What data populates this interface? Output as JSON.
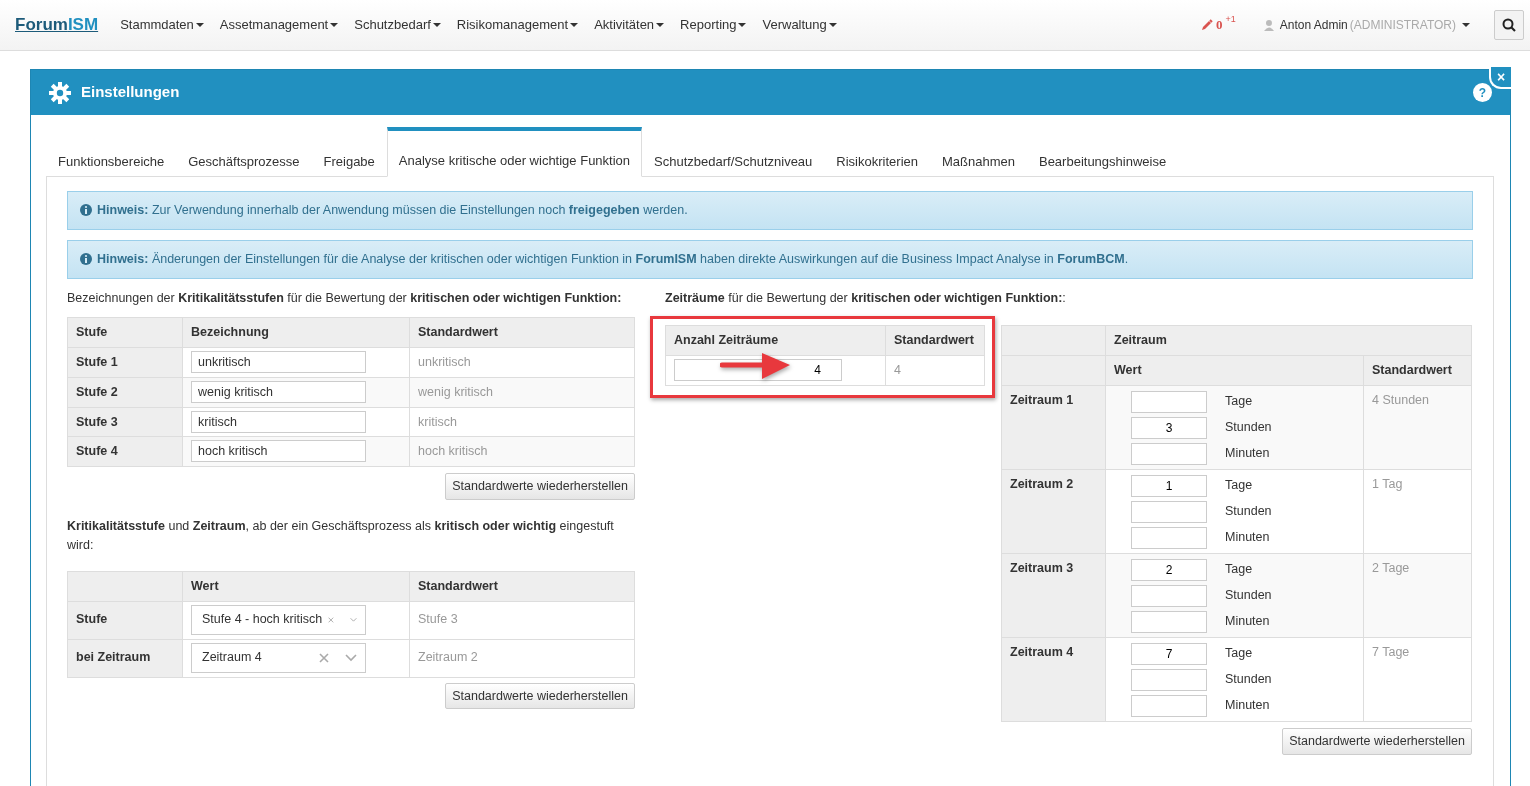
{
  "navbar": {
    "brand": [
      "Forum",
      "ISM"
    ],
    "menu": [
      "Stammdaten",
      "Assetmanagement",
      "Schutzbedarf",
      "Risikomanagement",
      "Aktivitäten",
      "Reporting",
      "Verwaltung"
    ],
    "edits": "0",
    "edits_delta": "+1",
    "user": "Anton Admin",
    "role": "(ADMINISTRATOR)"
  },
  "modal": {
    "title": "Einstellungen",
    "help": "?",
    "close": "×",
    "tabs": [
      {
        "label": "Funktionsbereiche",
        "selected": false
      },
      {
        "label": "Geschäftsprozesse",
        "selected": false
      },
      {
        "label": "Freigabe",
        "selected": false
      },
      {
        "label": "Analyse kritische oder wichtige Funktion",
        "selected": true
      },
      {
        "label": "Schutzbedarf/Schutzniveau",
        "selected": false
      },
      {
        "label": "Risikokriterien",
        "selected": false
      },
      {
        "label": "Maßnahmen",
        "selected": false
      },
      {
        "label": "Bearbeitungshinweise",
        "selected": false
      }
    ],
    "notices": [
      "**Hinweis:** Zur Verwendung innerhalb der Anwendung müssen die Einstellungen noch **freigegeben** werden.",
      "**Hinweis:** Änderungen der Einstellungen für die Analyse der kritischen oder wichtigen Funktion in **ForumISM** haben direkte Auswirkungen auf die Business Impact Analyse in **ForumBCM**."
    ],
    "levels": {
      "intro": "Bezeichnungen der **Kritikalitätsstufen** für die Bewertung der **kritischen oder wichtigen Funktion:**",
      "columns": [
        "Stufe",
        "Bezeichnung",
        "Standardwert"
      ],
      "rows": [
        {
          "label": "Stufe 1",
          "value": "unkritisch",
          "default": "unkritisch"
        },
        {
          "label": "Stufe 2",
          "value": "wenig kritisch",
          "default": "wenig kritisch"
        },
        {
          "label": "Stufe 3",
          "value": "kritisch",
          "default": "kritisch"
        },
        {
          "label": "Stufe 4",
          "value": "hoch kritisch",
          "default": "hoch kritisch"
        }
      ],
      "button": "Standardwerte wiederherstellen"
    },
    "threshold": {
      "intro": "**Kritikalitätsstufe** und **Zeitraum**, ab der ein Geschäftsprozess als **kritisch oder wichtig** eingestuft wird:",
      "columns": [
        "Wert",
        "Standardwert"
      ],
      "rows": [
        {
          "label": "Stufe",
          "value": "Stufe 4 - hoch kritisch",
          "default": "Stufe 3"
        },
        {
          "label": "bei Zeitraum",
          "value": "Zeitraum 4",
          "default": "Zeitraum 2"
        }
      ],
      "button": "Standardwerte wiederherstellen"
    },
    "periods_intro": "**Zeiträume** für die Bewertung der **kritischen oder wichtigen Funktion:**:",
    "count": {
      "columns": [
        "Anzahl Zeiträume",
        "Standardwert"
      ],
      "value": "4",
      "default": "4",
      "highlighted": true
    },
    "periods": {
      "group": "Zeitraum",
      "columns": [
        "Wert",
        "Standardwert"
      ],
      "rows": [
        {
          "label": "Zeitraum 1",
          "fields": [
            {
              "unit": "Tage"
            },
            {
              "value": "3",
              "unit": "Stunden"
            },
            {
              "unit": "Minuten"
            }
          ],
          "default": "4 Stunden"
        },
        {
          "label": "Zeitraum 2",
          "fields": [
            {
              "value": "1",
              "unit": "Tage"
            },
            {
              "unit": "Stunden"
            },
            {
              "unit": "Minuten"
            }
          ],
          "default": "1 Tag"
        },
        {
          "label": "Zeitraum 3",
          "fields": [
            {
              "value": "2",
              "unit": "Tage"
            },
            {
              "unit": "Stunden"
            },
            {
              "unit": "Minuten"
            }
          ],
          "default": "2 Tage"
        },
        {
          "label": "Zeitraum 4",
          "fields": [
            {
              "value": "7",
              "unit": "Tage"
            },
            {
              "unit": "Stunden"
            },
            {
              "unit": "Minuten"
            }
          ],
          "default": "7 Tage"
        }
      ],
      "button": "Standardwerte wiederherstellen"
    }
  }
}
